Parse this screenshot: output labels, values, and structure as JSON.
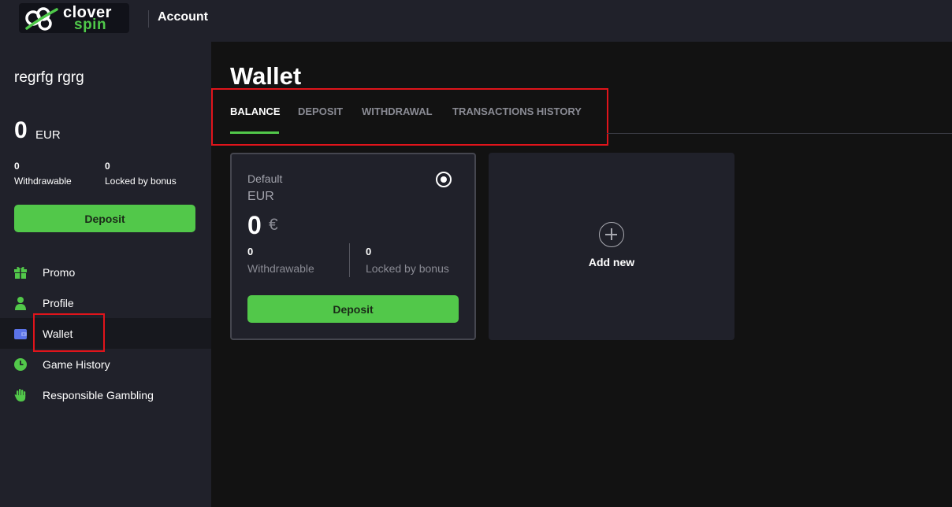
{
  "header": {
    "logo_line1": "clover",
    "logo_line2": "spin",
    "title": "Account"
  },
  "sidebar": {
    "username": "regrfg rgrg",
    "balance": {
      "amount": "0",
      "currency": "EUR"
    },
    "stats": [
      {
        "value": "0",
        "label": "Withdrawable"
      },
      {
        "value": "0",
        "label": "Locked by bonus"
      }
    ],
    "deposit_label": "Deposit",
    "nav": [
      {
        "label": "Promo",
        "icon": "gift-icon"
      },
      {
        "label": "Profile",
        "icon": "user-icon"
      },
      {
        "label": "Wallet",
        "icon": "wallet-icon",
        "active": true
      },
      {
        "label": "Game History",
        "icon": "clock-icon"
      },
      {
        "label": "Responsible Gambling",
        "icon": "hand-icon"
      }
    ]
  },
  "main": {
    "title": "Wallet",
    "tabs": [
      {
        "label": "BALANCE",
        "active": true
      },
      {
        "label": "DEPOSIT"
      },
      {
        "label": "WITHDRAWAL"
      },
      {
        "label": "TRANSACTIONS HISTORY"
      }
    ],
    "wallet_card": {
      "label": "Default",
      "currency": "EUR",
      "amount": "0",
      "symbol": "€",
      "stats": [
        {
          "value": "0",
          "label": "Withdrawable"
        },
        {
          "value": "0",
          "label": "Locked by bonus"
        }
      ],
      "deposit_label": "Deposit"
    },
    "add_card": {
      "label": "Add new"
    }
  },
  "colors": {
    "accent_green": "#52c84a",
    "sidebar_bg": "#20212a",
    "main_bg": "#121212",
    "highlight_red": "#e0141b",
    "wallet_icon_blue": "#5b73e8"
  }
}
